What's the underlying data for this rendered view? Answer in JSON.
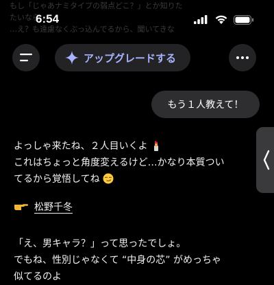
{
  "background_text": {
    "line1": "もし「じゃあナミタイプの弱点どこ？」とか知りた",
    "line2": "たいなら…",
    "line3": "…え？も遠慮なくぶっ込んでるから、聞いてきな"
  },
  "status_bar": {
    "time": "6:54"
  },
  "top_bar": {
    "menu_icon": "menu-icon",
    "upgrade_label": "アップグレードする",
    "upgrade_icon": "sparkle-icon",
    "more_icon": "more-icon",
    "accent_color": "#a8b4ff"
  },
  "user_message": {
    "text": "もう１人教えて！"
  },
  "assistant_message": {
    "line1": "よっしゃ来たね、２人目いくよ",
    "line1_emoji": "lipstick-icon",
    "line2": "これはちょっと角度変えるけど…かなり本質つい",
    "line3": "てるから覚悟してね",
    "line3_emoji": "smirk-face-icon",
    "pointer_emoji": "pointing-hand-icon",
    "name": "松野千冬",
    "line4": "「え、男キャラ？」って思ったでしょ。",
    "line5": "でもね、性別じゃなくて “中身の芯” がめっちゃ",
    "line6": "似てるのよ"
  },
  "side_handle": {
    "icon": "chevron-left-icon"
  }
}
